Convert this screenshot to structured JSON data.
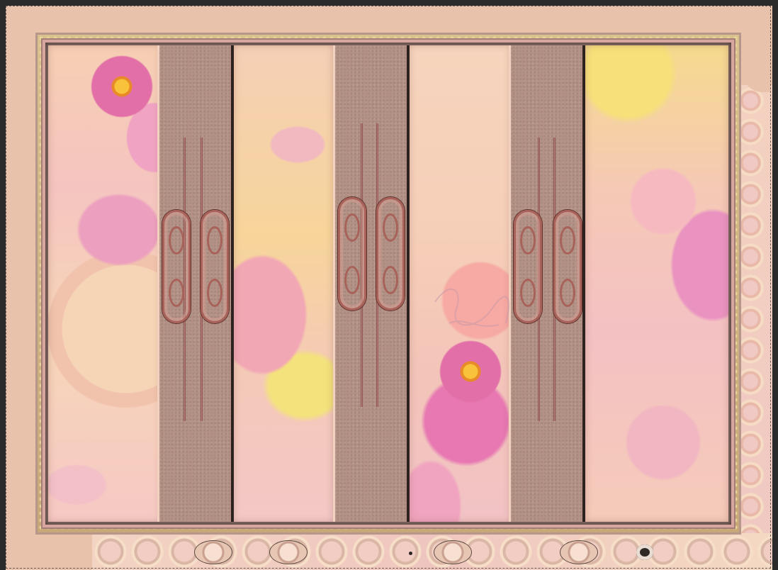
{
  "image": {
    "type": "decorative-collage",
    "theme": "pink cosmos flowers with brown ornamental columns",
    "colors": {
      "outer_frame": "#e9c2ab",
      "gold_border": "#d9c08c",
      "pink_border": "#d7a69f",
      "column_brown": "#b39185",
      "ornament": "#a8625a",
      "flower_pink": "#e26fa8",
      "flower_center": "#f8c23a"
    },
    "columns": [
      "brown-column",
      "brown-column",
      "brown-column"
    ],
    "art_panels": [
      "floral-panel",
      "floral-panel",
      "floral-panel",
      "floral-panel"
    ]
  }
}
